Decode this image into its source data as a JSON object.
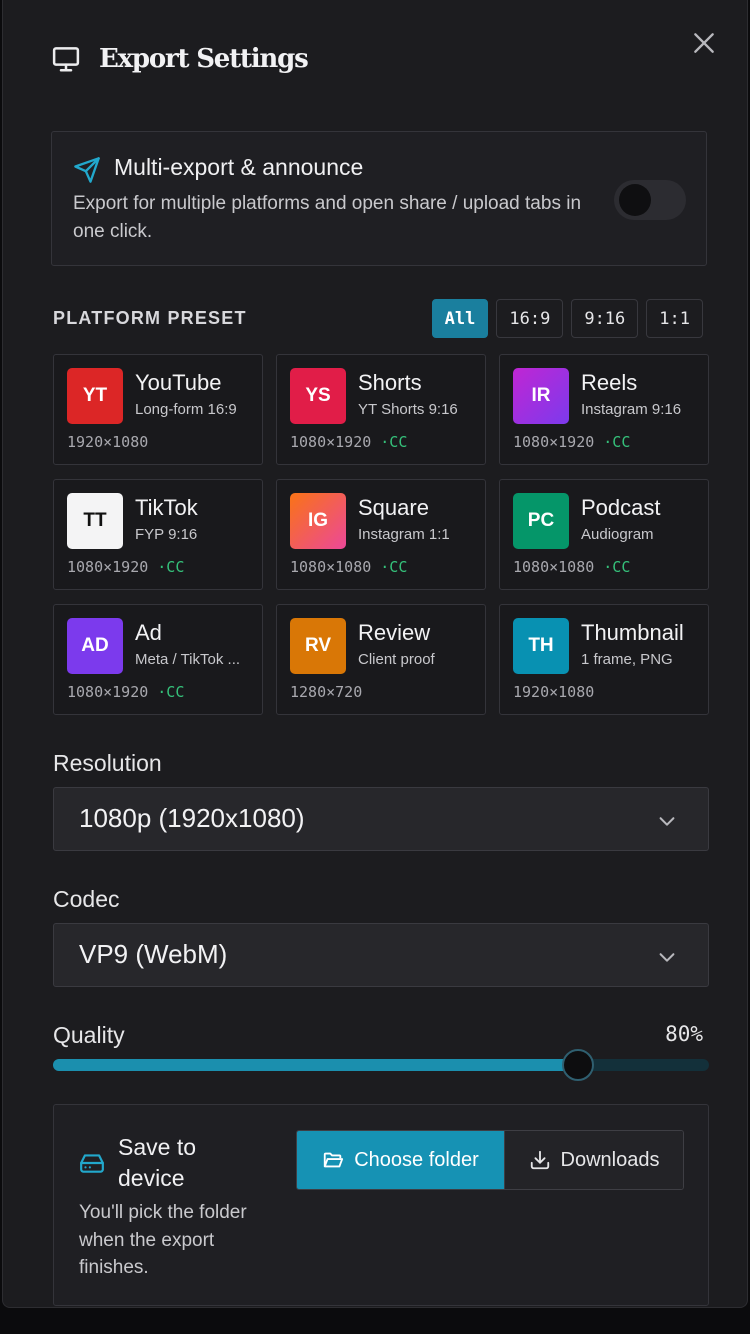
{
  "header": {
    "title": "Export Settings",
    "icon": "monitor-icon",
    "close_icon": "close-icon"
  },
  "multi_export": {
    "title": "Multi-export & announce",
    "description": "Export for multiple platforms and open share / upload tabs in one click.",
    "enabled": false,
    "icon": "send-icon"
  },
  "platform_preset": {
    "label": "PLATFORM PRESET",
    "filters": [
      "All",
      "16:9",
      "9:16",
      "1:1"
    ],
    "active_filter": "All",
    "cards": [
      {
        "badge": "YT",
        "color": "#dc2626",
        "name": "YouTube",
        "sub": "Long-form 16:9",
        "res": "1920×1080",
        "cc": ""
      },
      {
        "badge": "YS",
        "color": "#e11d48",
        "name": "Shorts",
        "sub": "YT Shorts 9:16",
        "res": "1080×1920",
        "cc": "·CC"
      },
      {
        "badge": "IR",
        "color": "#c026d3",
        "name": "Reels",
        "sub": "Instagram 9:16",
        "res": "1080×1920",
        "cc": "·CC"
      },
      {
        "badge": "TT",
        "color": "#f4f4f5",
        "name": "TikTok",
        "sub": "FYP 9:16",
        "res": "1080×1920",
        "cc": "·CC"
      },
      {
        "badge": "IG",
        "color": "#f97316",
        "name": "Square",
        "sub": "Instagram 1:1",
        "res": "1080×1080",
        "cc": "·CC"
      },
      {
        "badge": "PC",
        "color": "#059669",
        "name": "Podcast",
        "sub": "Audiogram",
        "res": "1080×1080",
        "cc": "·CC"
      },
      {
        "badge": "AD",
        "color": "#7c3aed",
        "name": "Ad",
        "sub": "Meta / TikTok ...",
        "res": "1080×1920",
        "cc": "·CC"
      },
      {
        "badge": "RV",
        "color": "#d97706",
        "name": "Review",
        "sub": "Client proof",
        "res": "1280×720",
        "cc": ""
      },
      {
        "badge": "TH",
        "color": "#0891b2",
        "name": "Thumbnail",
        "sub": "1 frame, PNG",
        "res": "1920×1080",
        "cc": ""
      }
    ]
  },
  "resolution": {
    "label": "Resolution",
    "value": "1080p (1920x1080)"
  },
  "codec": {
    "label": "Codec",
    "value": "VP9 (WebM)"
  },
  "quality": {
    "label": "Quality",
    "value_text": "80%",
    "fraction": 0.8
  },
  "save": {
    "title": "Save to device",
    "description": "You'll pick the folder when the export finishes.",
    "choose_label": "Choose folder",
    "downloads_label": "Downloads",
    "active": "choose"
  },
  "colors": {
    "accent": "#1692b4",
    "cc_green": "#35c07a",
    "background": "#1c1c1f"
  }
}
